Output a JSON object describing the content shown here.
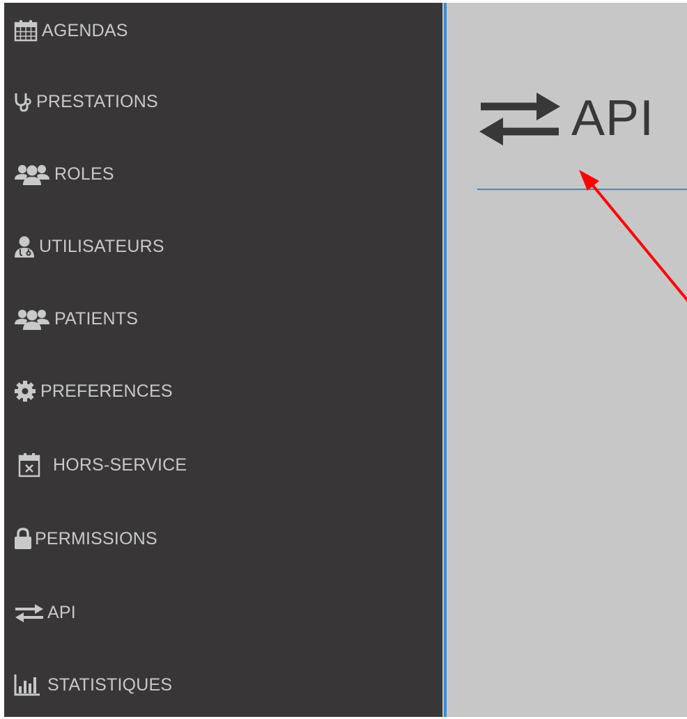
{
  "sidebar": {
    "items": [
      {
        "label": "AGENDAS",
        "icon": "calendar-icon"
      },
      {
        "label": "PRESTATIONS",
        "icon": "stethoscope-icon"
      },
      {
        "label": "ROLES",
        "icon": "users-icon"
      },
      {
        "label": "UTILISATEURS",
        "icon": "user-doctor-icon"
      },
      {
        "label": "PATIENTS",
        "icon": "users-icon"
      },
      {
        "label": "PREFERENCES",
        "icon": "gear-icon"
      },
      {
        "label": "HORS-SERVICE",
        "icon": "calendar-times-icon"
      },
      {
        "label": "PERMISSIONS",
        "icon": "lock-icon"
      },
      {
        "label": "API",
        "icon": "exchange-icon"
      },
      {
        "label": "STATISTIQUES",
        "icon": "bar-chart-icon"
      }
    ]
  },
  "main": {
    "title": "API",
    "title_icon": "exchange-icon"
  },
  "annotation": {
    "type": "red-arrow",
    "color": "#ff0000"
  },
  "colors": {
    "sidebar_bg": "#383636",
    "sidebar_text": "#c9c9c9",
    "main_bg": "#c7c7c7",
    "accent": "#2f8fe0",
    "title_text": "#383838"
  }
}
